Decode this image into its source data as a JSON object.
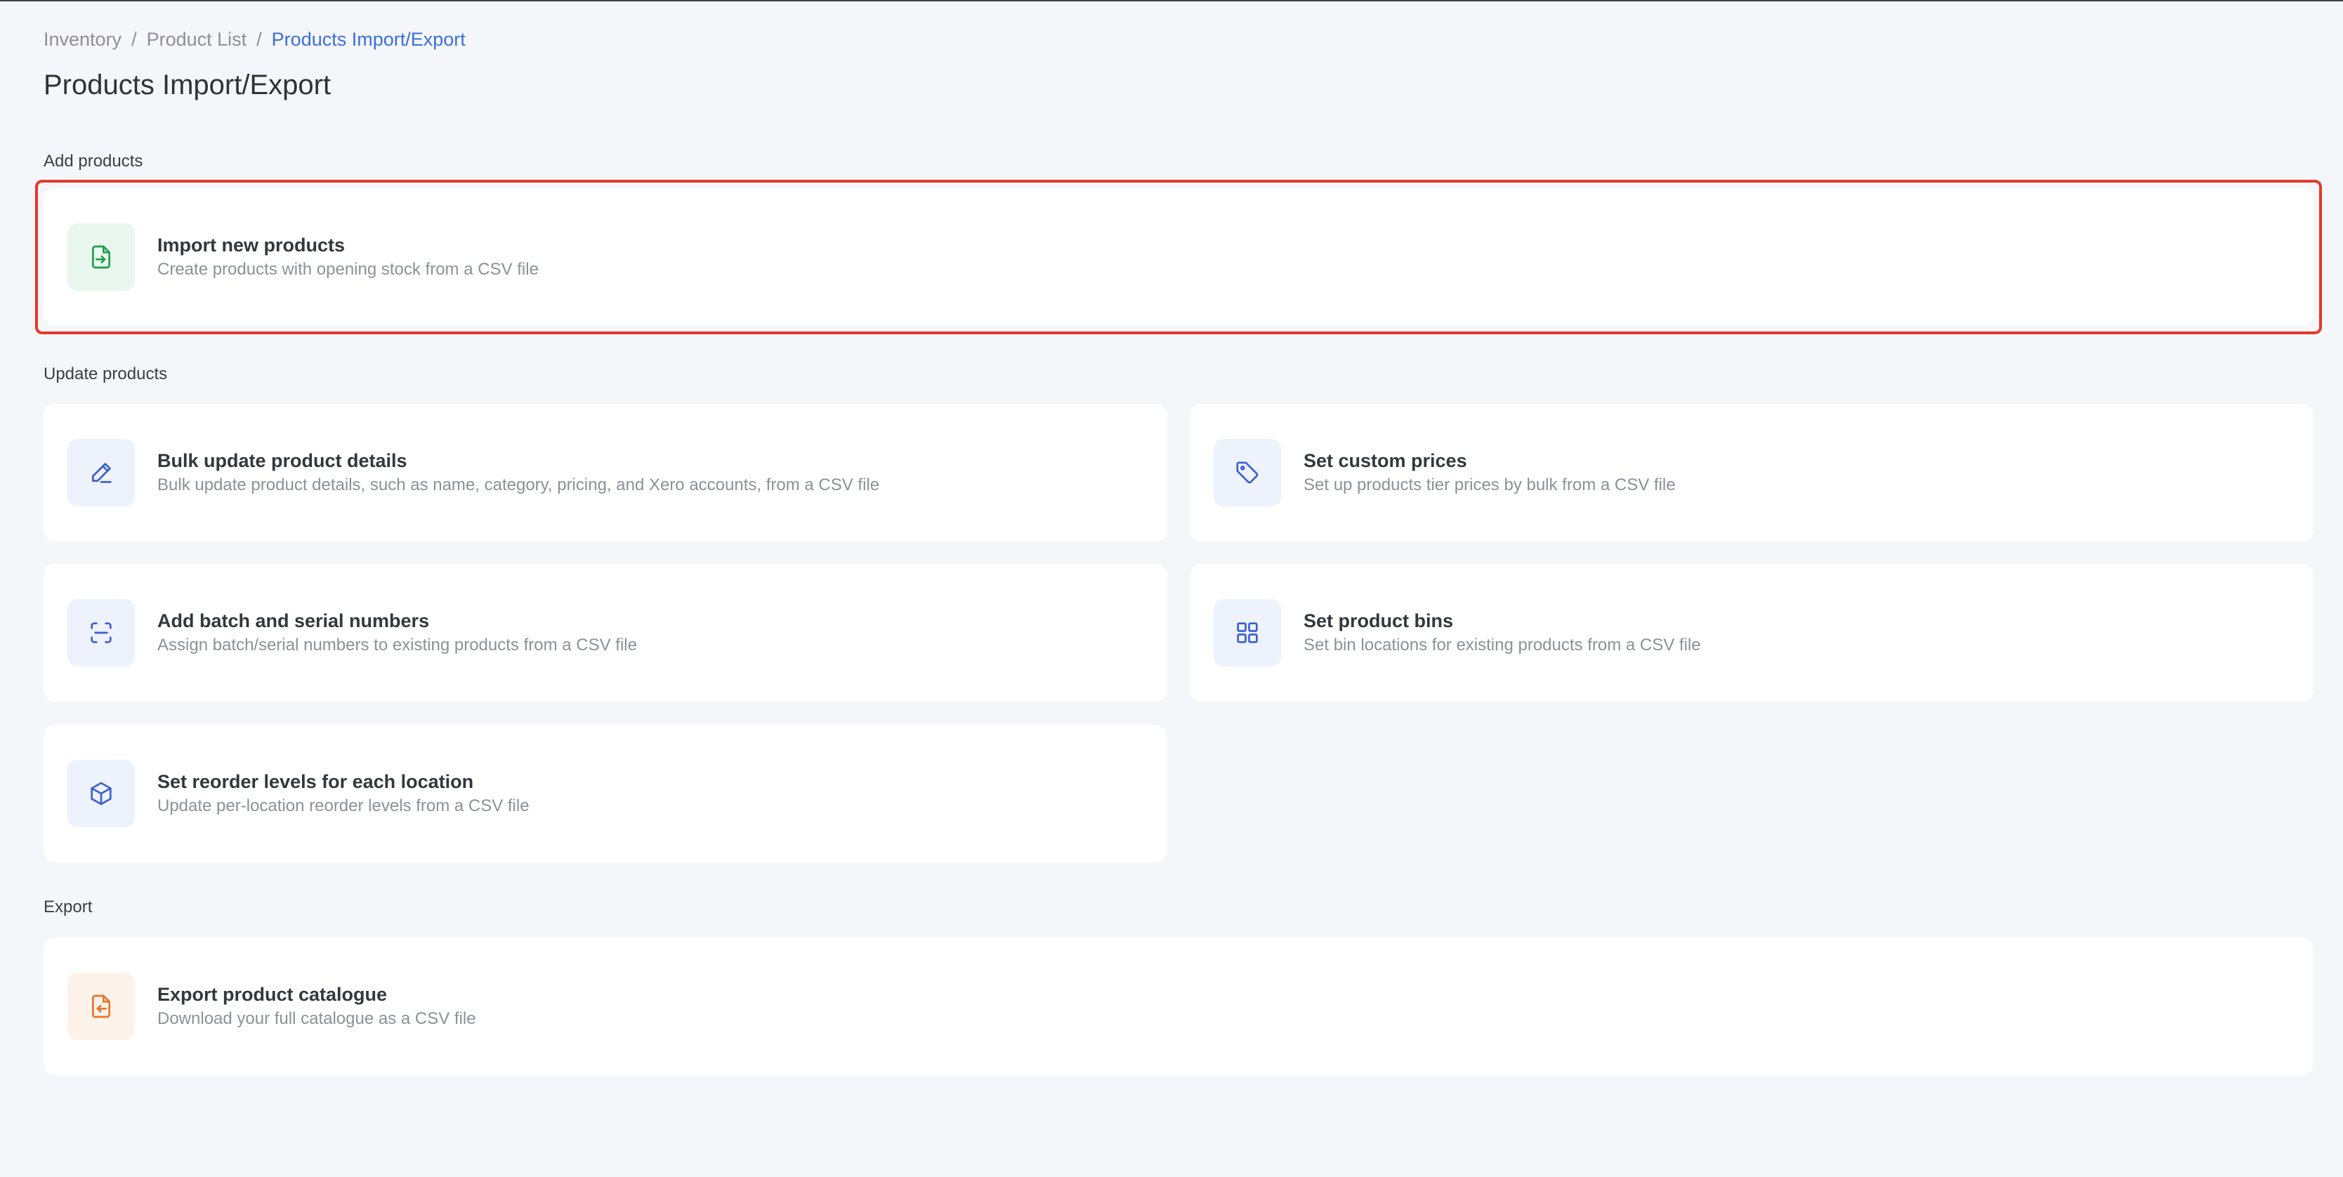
{
  "breadcrumb": {
    "items": [
      "Inventory",
      "Product List",
      "Products Import/Export"
    ],
    "separator": "/"
  },
  "page": {
    "title": "Products Import/Export"
  },
  "sections": {
    "add": {
      "label": "Add products",
      "cards": {
        "import": {
          "title": "Import new products",
          "description": "Create products with opening stock from a CSV file",
          "icon": "file-import-icon"
        }
      }
    },
    "update": {
      "label": "Update products",
      "cards": {
        "bulk": {
          "title": "Bulk update product details",
          "description": "Bulk update product details, such as name, category, pricing, and Xero accounts, from a CSV file",
          "icon": "pencil-icon"
        },
        "prices": {
          "title": "Set custom prices",
          "description": "Set up products tier prices by bulk from a CSV file",
          "icon": "tag-icon"
        },
        "batch": {
          "title": "Add batch and serial numbers",
          "description": "Assign batch/serial numbers to existing products from a CSV file",
          "icon": "scan-icon"
        },
        "bins": {
          "title": "Set product bins",
          "description": "Set bin locations for existing products from a CSV file",
          "icon": "grid-icon"
        },
        "reorder": {
          "title": "Set reorder levels for each location",
          "description": "Update per-location reorder levels from a CSV file",
          "icon": "box-icon"
        }
      }
    },
    "export": {
      "label": "Export",
      "cards": {
        "catalogue": {
          "title": "Export product catalogue",
          "description": "Download your full catalogue as a CSV file",
          "icon": "file-export-icon"
        }
      }
    }
  },
  "colors": {
    "background": "#f5f6fa",
    "link": "#3a6fdc",
    "green": "#1f9d4c",
    "blue": "#3b5fcf",
    "orange": "#e8742a",
    "highlight": "#e23a2a"
  }
}
